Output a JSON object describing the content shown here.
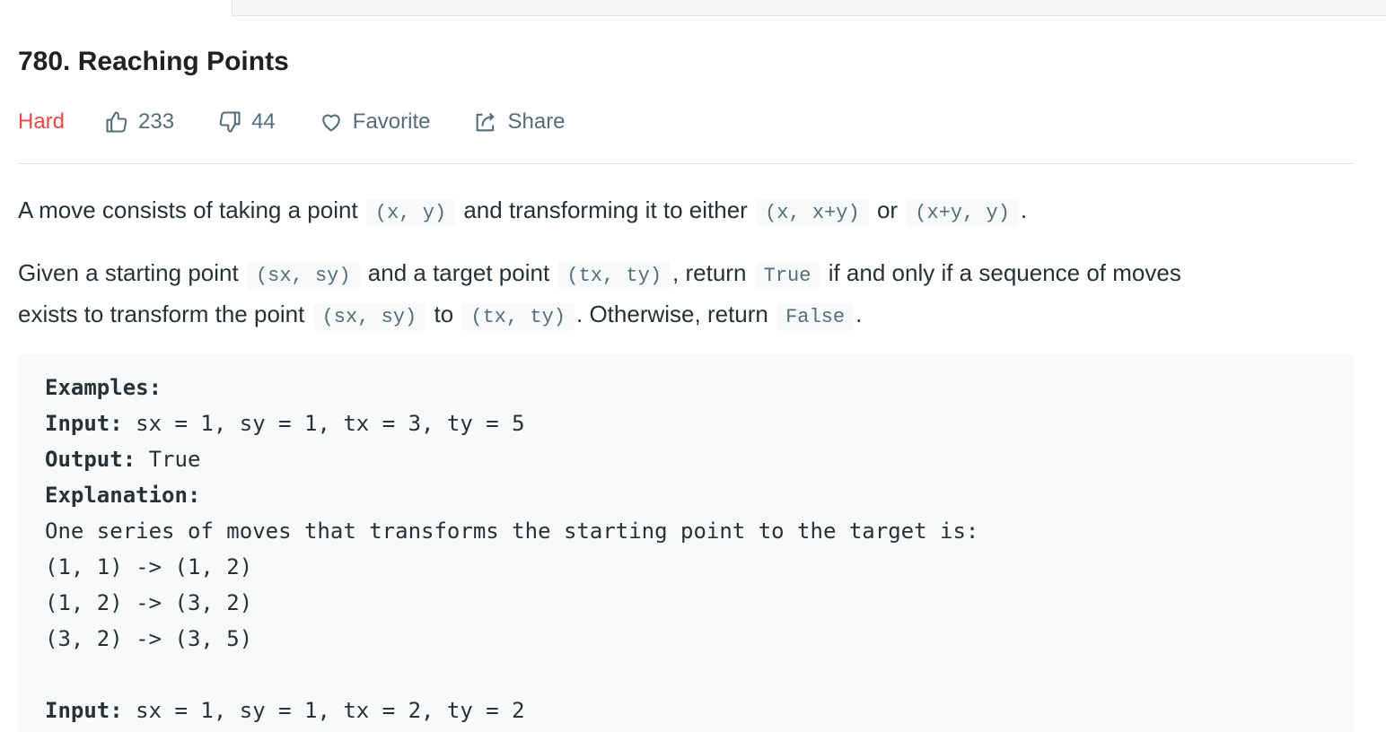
{
  "problem": {
    "title": "780. Reaching Points",
    "difficulty": "Hard",
    "likes": "233",
    "dislikes": "44",
    "favorite_label": "Favorite",
    "share_label": "Share",
    "colors": {
      "difficulty_hard": "#ef4743",
      "meta_text": "#546e7a"
    }
  },
  "description": {
    "p1": {
      "t1": "A move consists of taking a point",
      "c1": "(x, y)",
      "t2": "and transforming it to either",
      "c2": "(x, x+y)",
      "t3": "or",
      "c3": "(x+y, y)",
      "t4": "."
    },
    "p2": {
      "t1": "Given a starting point",
      "c1": "(sx, sy)",
      "t2": "and a target point",
      "c2": "(tx, ty)",
      "t3": ", return",
      "c3": "True",
      "t4": "if and only if a sequence of moves",
      "t5": "exists to transform the point",
      "c4": "(sx, sy)",
      "t6": "to",
      "c5": "(tx, ty)",
      "t7": ". Otherwise, return",
      "c6": "False",
      "t8": "."
    }
  },
  "example": {
    "heading": "Examples:",
    "input_label": "Input:",
    "output_label": "Output:",
    "explanation_label": "Explanation:",
    "input1": " sx = 1, sy = 1, tx = 3, ty = 5",
    "output1": " True",
    "expl_line": "One series of moves that transforms the starting point to the target is:",
    "moves": [
      "(1, 1) -> (1, 2)",
      "(1, 2) -> (3, 2)",
      "(3, 2) -> (3, 5)"
    ],
    "input2": " sx = 1, sy = 1, tx = 2, ty = 2"
  }
}
